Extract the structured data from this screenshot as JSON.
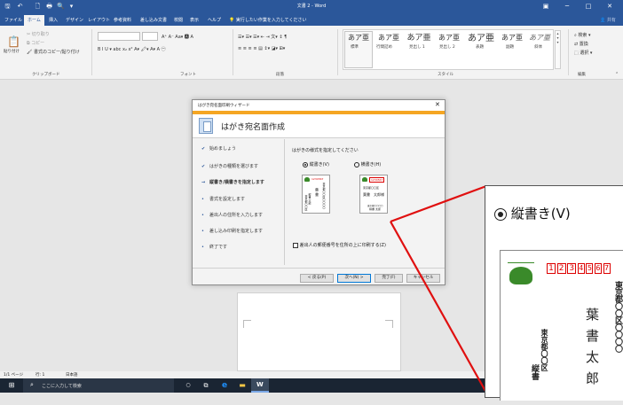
{
  "window": {
    "title": "文書 2 - Word",
    "minimize": "─",
    "maximize": "□",
    "close": "✕",
    "quick_access": [
      "🖫",
      "↶",
      "🗋",
      "🖶",
      "🔍",
      "▾"
    ]
  },
  "ribbon_tabs": [
    "ファイル",
    "ホーム",
    "挿入",
    "デザイン",
    "レイアウト",
    "参考資料",
    "差し込み文書",
    "校閲",
    "表示",
    "ヘルプ"
  ],
  "tell_me": "実行したい作業を入力してください",
  "share": "共有",
  "clipboard": {
    "paste": "貼り付け",
    "cut": "切り取り",
    "copy": "コピー",
    "format_painter": "書式のコピー/貼り付け",
    "group": "クリップボード"
  },
  "font": {
    "controls_row1": "A⁺ A⁻ Aa▾ 🅰 A",
    "controls_row2": "B I U ▾ abc x₂ x²  A▾ 🖍▾ A▾ A ㊀",
    "group": "フォント"
  },
  "paragraph": {
    "controls_row1": "☰▾ ☰▾ ☰▾ ⇤ ⇥ 文▾ ↕ ¶",
    "controls_row2": "≡ ≡ ≡ ≡ ▤ ↕▾ ◪▾ ⊞▾",
    "group": "段落"
  },
  "styles": {
    "items": [
      {
        "sample": "あア亜",
        "name": "標準"
      },
      {
        "sample": "あア亜",
        "name": "行間詰め"
      },
      {
        "sample": "あア亜",
        "name": "見出し 1"
      },
      {
        "sample": "あア亜",
        "name": "見出し 2"
      },
      {
        "sample": "あア亜",
        "name": "表題"
      },
      {
        "sample": "あア亜",
        "name": "副題"
      },
      {
        "sample": "あア亜",
        "name": "斜体"
      }
    ],
    "group": "スタイル"
  },
  "editing": {
    "find": "検索",
    "replace": "置換",
    "select": "選択",
    "group": "編集"
  },
  "status_bar": {
    "page": "1/1 ページ",
    "line": "行: 1",
    "language": "日本語"
  },
  "taskbar": {
    "search_placeholder": "ここに入力して検索"
  },
  "dialog": {
    "title": "はがき宛名面印刷ウィザード",
    "header": "はがき宛名面作成",
    "steps": [
      {
        "mark": "✔",
        "label": "始めましょう"
      },
      {
        "mark": "✔",
        "label": "はがきの種類を選びます"
      },
      {
        "mark": "→",
        "label": "縦書き/横書きを指定します"
      },
      {
        "mark": "•",
        "label": "書式を設定します"
      },
      {
        "mark": "•",
        "label": "差出人の住所を入力します"
      },
      {
        "mark": "•",
        "label": "差し込み印刷を指定します"
      },
      {
        "mark": "•",
        "label": "終了です"
      }
    ],
    "prompt": "はがきの様式を指定してください",
    "vertical_label": "縦書き(V)",
    "horizontal_label": "横書き(H)",
    "postal_checkbox": "差出人の郵便番号を住所の上に印刷する(Z)",
    "buttons": {
      "back": "< 戻る(P)",
      "next": "次へ(N) >",
      "finish": "完了(F)",
      "cancel": "キャンセル"
    },
    "preview_vertical": {
      "zip": [
        "1",
        "2",
        "3",
        "4",
        "5",
        "6",
        "7"
      ],
      "name_col": "葉 書",
      "addr_col": "東京都〇〇区〇〇〇〇",
      "sender": "縦書 太郎",
      "sender_addr": "東京都〇〇区"
    },
    "preview_horizontal": {
      "zip": "1234567",
      "address": "東京都〇〇区",
      "name": "葉書　太郎様",
      "sender_addr": "東京都〇〇〇〇",
      "sender": "横書 太郎"
    }
  },
  "zoom_callout": {
    "label": "縦書き(V)",
    "zip": [
      "1",
      "2",
      "3",
      "4",
      "5",
      "6",
      "7"
    ],
    "name_chars": [
      "葉",
      "書",
      "太",
      "郎"
    ],
    "addr_col": "東京都〇〇区〇〇〇〇",
    "sender_col": "東京都〇〇区",
    "sender_name": "縦書"
  },
  "colors": {
    "word_blue": "#2b579a",
    "wizard_band": "#f5a623",
    "callout_red": "#e01010",
    "stamp_green": "#3a8a2a"
  }
}
